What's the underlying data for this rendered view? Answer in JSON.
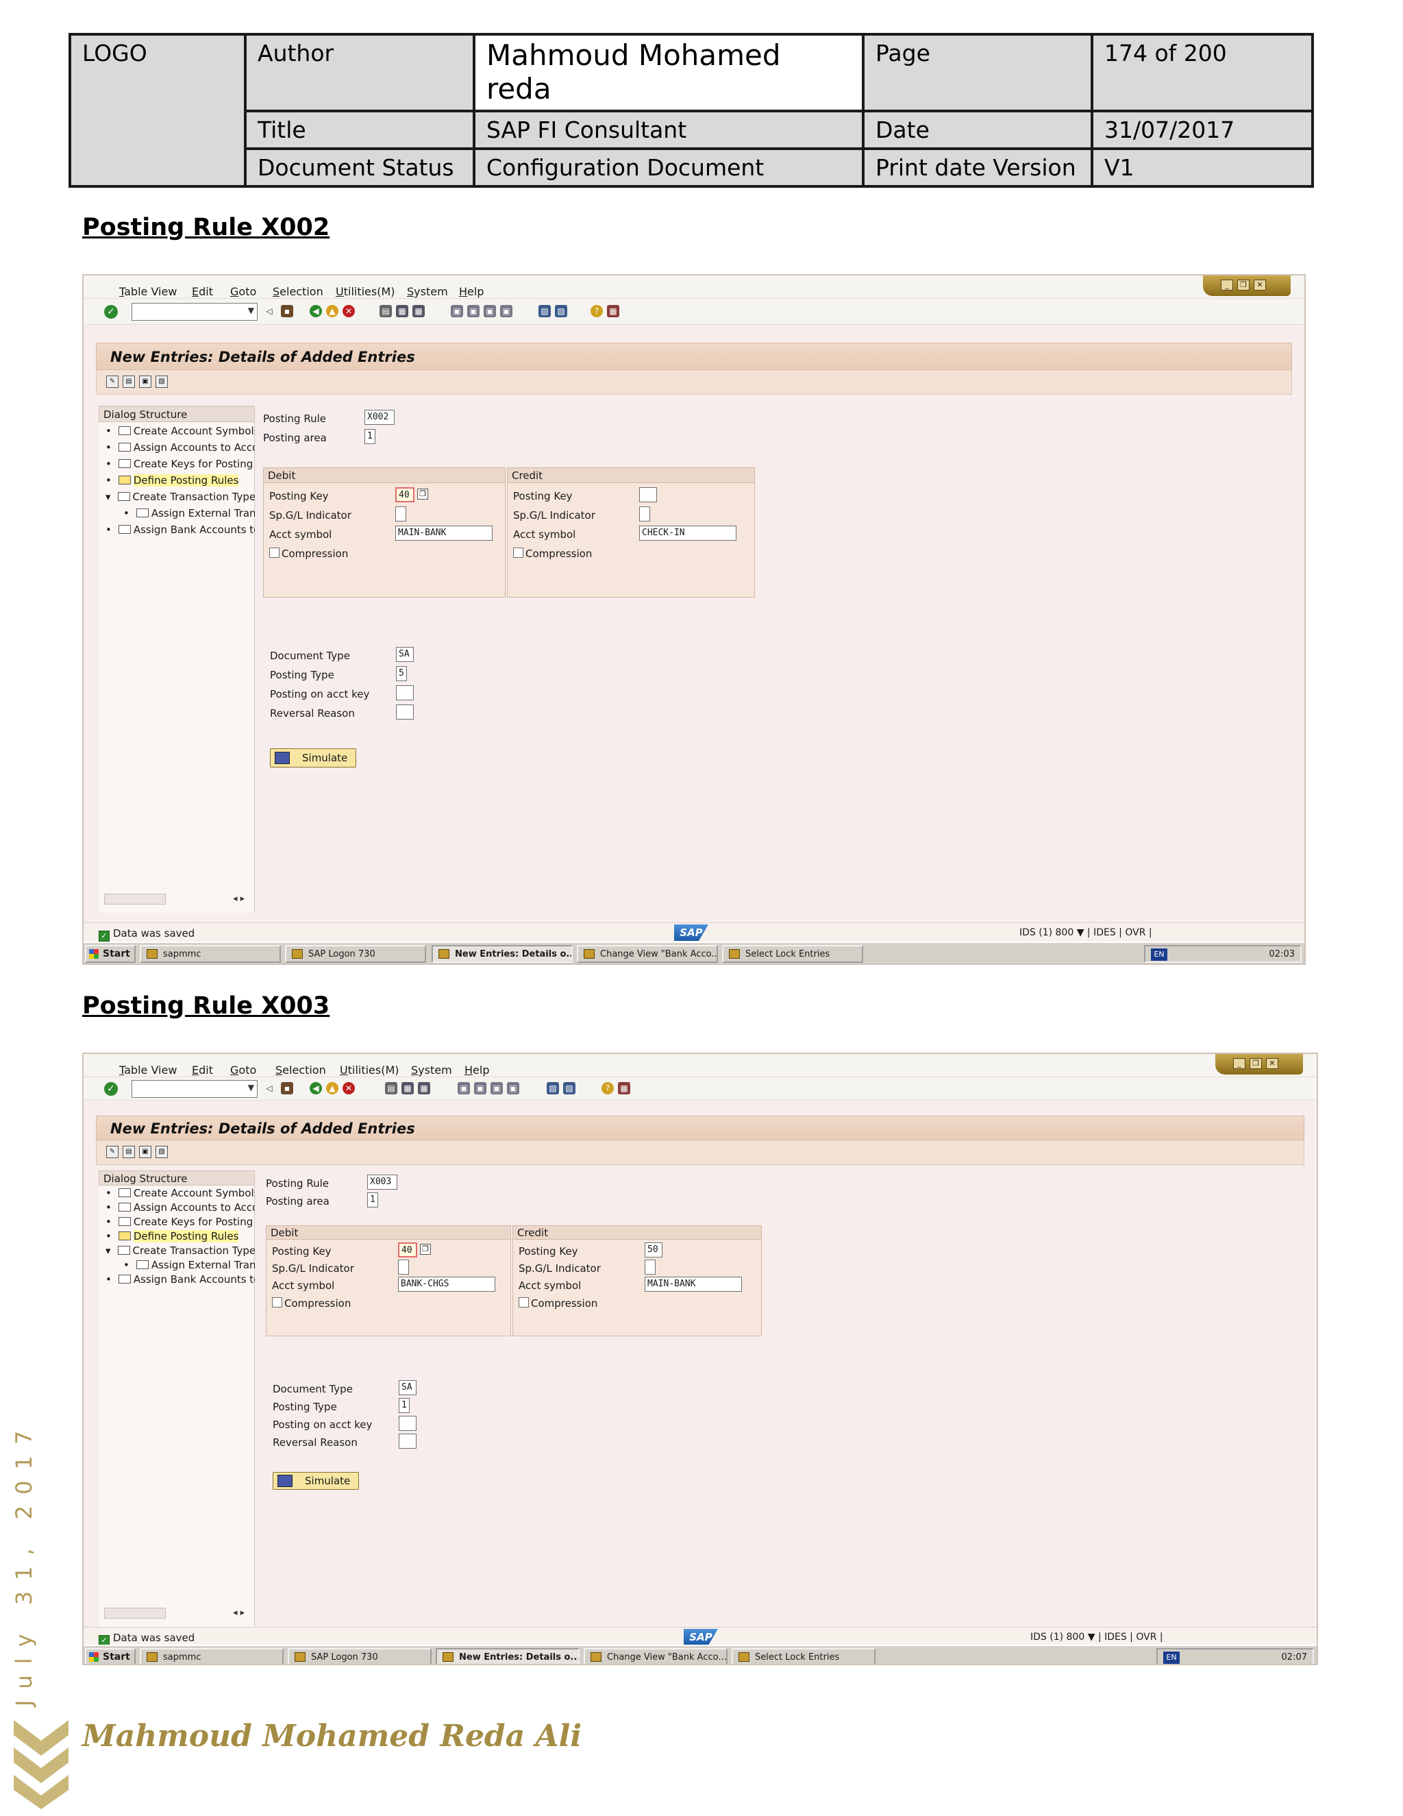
{
  "header": {
    "logo": "LOGO",
    "author_label": "Author",
    "author_value": "Mahmoud Mohamed reda",
    "page_label": "Page",
    "page_value": "174 of 200",
    "title_label": "Title",
    "title_value": "SAP FI Consultant",
    "date_label": "Date",
    "date_value": "31/07/2017",
    "status_label": "Document Status",
    "status_value": "Configuration Document",
    "version_label": "Print date Version",
    "version_value": "V1"
  },
  "sections": [
    {
      "heading": "Posting Rule X002",
      "sap": {
        "menu": [
          "Table View",
          "Edit",
          "Goto",
          "Selection",
          "Utilities(M)",
          "System",
          "Help"
        ],
        "screen_title": "New Entries: Details of Added Entries",
        "dialog_structure": "Dialog Structure",
        "nav_items": [
          "Create Account Symbols",
          "Assign Accounts to Account Symbols",
          "Create Keys for Posting Rules",
          "Define Posting Rules",
          "Create Transaction Types",
          "Assign External Transaction Types",
          "Assign Bank Accounts to Transaction Types"
        ],
        "posting_rule_label": "Posting Rule",
        "posting_rule": "X002",
        "posting_area_label": "Posting area",
        "posting_area": "1",
        "debit": {
          "title": "Debit",
          "posting_key_label": "Posting Key",
          "posting_key": "40",
          "spgl_label": "Sp.G/L Indicator",
          "spgl": "",
          "acct_symbol_label": "Acct symbol",
          "acct_symbol": "MAIN-BANK",
          "compression_label": "Compression"
        },
        "credit": {
          "title": "Credit",
          "posting_key_label": "Posting Key",
          "posting_key": "",
          "spgl_label": "Sp.G/L Indicator",
          "spgl": "",
          "acct_symbol_label": "Acct symbol",
          "acct_symbol": "CHECK-IN",
          "compression_label": "Compression"
        },
        "doc_type_label": "Document Type",
        "doc_type": "SA",
        "posting_type_label": "Posting Type",
        "posting_type": "5",
        "posting_on_acct_label": "Posting on acct key",
        "posting_on_acct": "",
        "reversal_label": "Reversal Reason",
        "reversal": "",
        "simulate_label": "Simulate",
        "status_msg": "Data was saved",
        "sap_logo": "SAP",
        "sysinfo": "IDS (1) 800 ▼ | IDES | OVR |",
        "taskbar": {
          "start": "Start",
          "tasks": [
            "sapmmc",
            "SAP Logon 730",
            "New Entries: Details o...",
            "Change View \"Bank Acco...",
            "Select Lock Entries"
          ],
          "lang": "EN",
          "time": "02:03"
        }
      }
    },
    {
      "heading": "Posting Rule X003",
      "sap": {
        "menu": [
          "Table View",
          "Edit",
          "Goto",
          "Selection",
          "Utilities(M)",
          "System",
          "Help"
        ],
        "screen_title": "New Entries: Details of Added Entries",
        "dialog_structure": "Dialog Structure",
        "nav_items": [
          "Create Account Symbols",
          "Assign Accounts to Account Symbols",
          "Create Keys for Posting Rules",
          "Define Posting Rules",
          "Create Transaction Types",
          "Assign External Transaction Types",
          "Assign Bank Accounts to Transaction Types"
        ],
        "posting_rule_label": "Posting Rule",
        "posting_rule": "X003",
        "posting_area_label": "Posting area",
        "posting_area": "1",
        "debit": {
          "title": "Debit",
          "posting_key_label": "Posting Key",
          "posting_key": "40",
          "spgl_label": "Sp.G/L Indicator",
          "spgl": "",
          "acct_symbol_label": "Acct symbol",
          "acct_symbol": "BANK-CHGS",
          "compression_label": "Compression"
        },
        "credit": {
          "title": "Credit",
          "posting_key_label": "Posting Key",
          "posting_key": "50",
          "spgl_label": "Sp.G/L Indicator",
          "spgl": "",
          "acct_symbol_label": "Acct symbol",
          "acct_symbol": "MAIN-BANK",
          "compression_label": "Compression"
        },
        "doc_type_label": "Document Type",
        "doc_type": "SA",
        "posting_type_label": "Posting Type",
        "posting_type": "1",
        "posting_on_acct_label": "Posting on acct key",
        "posting_on_acct": "",
        "reversal_label": "Reversal Reason",
        "reversal": "",
        "simulate_label": "Simulate",
        "status_msg": "Data was saved",
        "sap_logo": "SAP",
        "sysinfo": "IDS (1) 800 ▼ | IDES | OVR |",
        "taskbar": {
          "start": "Start",
          "tasks": [
            "sapmmc",
            "SAP Logon 730",
            "New Entries: Details o...",
            "Change View \"Bank Acco...",
            "Select Lock Entries"
          ],
          "lang": "EN",
          "time": "02:07"
        }
      }
    }
  ],
  "footer": {
    "side_date": "July 31, 2017",
    "name": "Mahmoud Mohamed Reda Ali"
  }
}
